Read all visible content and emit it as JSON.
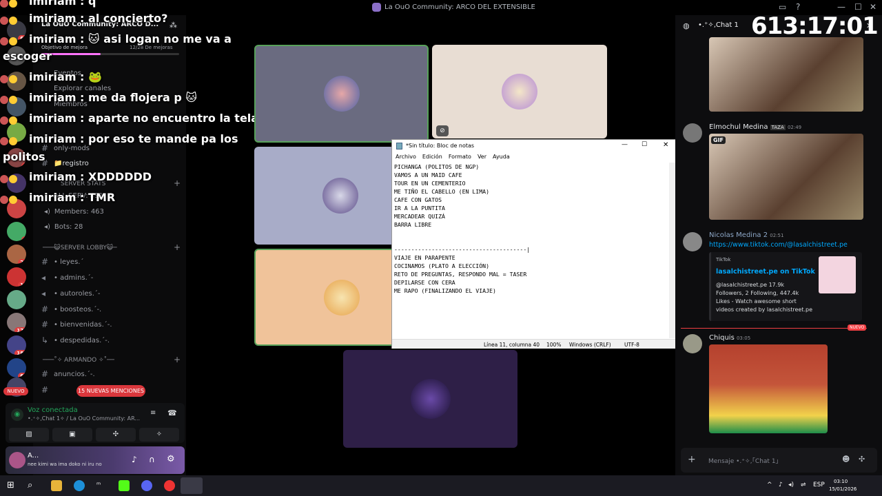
{
  "window": {
    "title": "La OuO Community: ARCO DEL EXTENSIBLE"
  },
  "overlay": {
    "lines": [
      "imiriam : q",
      "imiriam : al concierto?",
      "imiriam : 🐱 asi logan no me va a",
      "escoger",
      "imiriam : 🐸",
      "imiriam : me da flojera p 🐱",
      "imiriam : aparte no encuentro la tela",
      "imiriam : por eso te mande pa los",
      "politos",
      "imiriam : XDDDDDD",
      "imiriam : TMR"
    ]
  },
  "sidebar": {
    "server_name": "La OuO Community: ARCO D...",
    "goal_label": "Objetivo de mejora",
    "goal_progress": "12/28 De mejoras",
    "goal_fraction": 0.43,
    "items": [
      "Eventos",
      "Explorar canales",
      "Miembros"
    ],
    "channels_top": [
      {
        "icon": "#",
        "name": "only-mods"
      },
      {
        "icon": "#",
        "name": "📁registro"
      }
    ],
    "stats_category": "SERVER STATS",
    "stats": [
      "ALL SERV: 491",
      "Members: 463",
      "Bots: 28"
    ],
    "lobby_category": "───😺SERVER LOBBY😺─",
    "lobby_channels": [
      "• leyes.´",
      "• admins.´-",
      "• autoroles.´-",
      "• boosteos.´-.",
      "• bienvenidas.´-.",
      "• despedidas.´-."
    ],
    "armando_category": "───˚✧ ARMANDO ✧˚──",
    "armando_channels": [
      "anuncios.´-."
    ],
    "mentions": "15 NUEVAS MENCIONES",
    "nuevo": "NUEVO",
    "voice": {
      "status": "Voz conectada",
      "channel": "•.⁺✧‚Chat 1✧ / La OuO Community: AR..."
    },
    "user": {
      "name": "A...",
      "status": "nee kimi wa ima doko ni iru no"
    }
  },
  "rail_badges": [
    "62",
    "1",
    "2",
    "27",
    "18",
    "179",
    "180",
    "68"
  ],
  "notepad": {
    "title": "*Sin título: Bloc de notas",
    "menu": [
      "Archivo",
      "Edición",
      "Formato",
      "Ver",
      "Ayuda"
    ],
    "text": "PICHANGA (POLITOS DE NGP)\nVAMOS A UN MAID CAFE\nTOUR EN UN CEMENTERIO\nME TIÑO EL CABELLO (EN LIMA)\nCAFE CON GATOS\nIR A LA PUNTITA\nMERCADEAR QUIZÁ\nBARRA LIBRE\n\n\n---------------------------------------|\nVIAJE EN PARAPENTE\nCOCINAMOS (PLATO A ELECCIÓN)\nRETO DE PREGUNTAS, RESPONDO MAL = TASER\nDEPILARSE CON CERA\nME RAPO (FINALIZANDO EL VIAJE)",
    "status": {
      "position": "Línea 11, columna 40",
      "zoom": "100%",
      "eol": "Windows (CRLF)",
      "encoding": "UTF-8"
    }
  },
  "chat": {
    "channel": "•.⁺✧‚Chat 1",
    "timer": "613:17:01",
    "messages": [
      {
        "author": "Elmochul Medina",
        "tag": "TAZA",
        "time": "02:49",
        "gif": "GIF"
      },
      {
        "author": "Nicolas Medina 2",
        "time": "02:51",
        "link": "https://www.tiktok.com/@lasalchistreet.pe",
        "embed": {
          "provider": "TikTok",
          "title": "lasalchistreet.pe on TikTok",
          "desc": "@lasalchistreet.pe 17.9k Followers, 2 Following, 447.4k Likes - Watch awesome short videos created by lasalchistreet.pe"
        }
      },
      {
        "author": "Chiquis",
        "time": "03:05"
      }
    ],
    "new_label": "NUEVO",
    "input_placeholder": "Mensaje •.⁺✧‚「Chat 1」"
  },
  "taskbar": {
    "lang": "ESP",
    "time": "03:10",
    "date": "15/01/2026"
  },
  "colors": {
    "accent": "#5865f2",
    "danger": "#da373c",
    "online": "#23a55a"
  }
}
